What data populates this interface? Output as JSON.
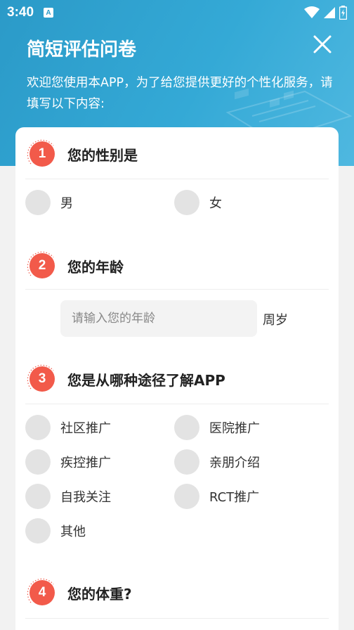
{
  "status": {
    "time": "3:40",
    "a_badge": "A"
  },
  "header": {
    "title": "简短评估问卷",
    "intro": "欢迎您使用本APP，为了给您提供更好的个性化服务，请填写以下内容:"
  },
  "colors": {
    "header": "#2b9ac8",
    "accent": "#f25a4a",
    "radio": "#e3e3e3"
  },
  "questions": [
    {
      "num": "1",
      "title": "您的性别是",
      "options": [
        "男",
        "女"
      ]
    },
    {
      "num": "2",
      "title": "您的年龄",
      "input_placeholder": "请输入您的年龄",
      "unit": "周岁"
    },
    {
      "num": "3",
      "title": "您是从哪种途径了解APP",
      "options": [
        "社区推广",
        "医院推广",
        "疾控推广",
        "亲朋介绍",
        "自我关注",
        "RCT推广",
        "其他"
      ]
    },
    {
      "num": "4",
      "title": "您的体重?"
    }
  ]
}
